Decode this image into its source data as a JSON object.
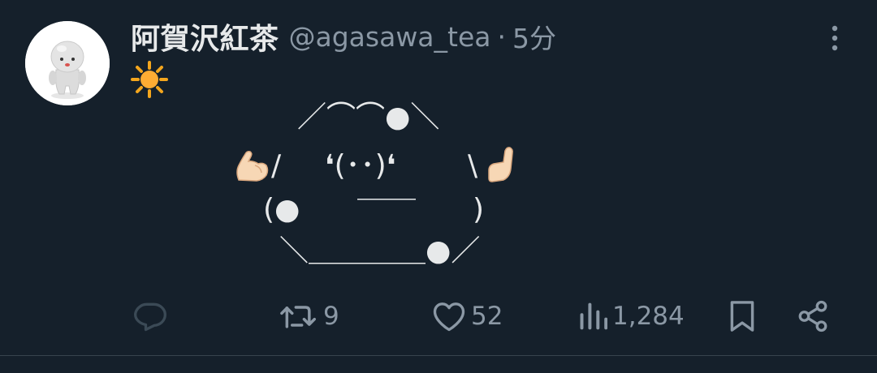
{
  "tweet": {
    "author": {
      "display_name": "阿賀沢紅茶",
      "handle": "@agasawa_tea",
      "separator": "·",
      "time": "5分"
    },
    "body": {
      "emoji_icon": "sun-icon",
      "ascii_art": {
        "line1": "／⌒⌒●＼",
        "line2_left": "/",
        "line2_face": "❛(･･)❛",
        "line2_right": "\\",
        "line3_mouth": "＿＿",
        "line4_left": "(●",
        "line4_right": ")",
        "line5": "＼＿＿＿＿●／",
        "left_icon": "flexed-biceps-icon",
        "right_icon": "raised-hand-icon"
      }
    },
    "actions": {
      "reply": {
        "icon": "reply-icon",
        "count": ""
      },
      "retweet": {
        "icon": "retweet-icon",
        "count": "9"
      },
      "like": {
        "icon": "heart-icon",
        "count": "52"
      },
      "views": {
        "icon": "views-icon",
        "count": "1,284"
      },
      "bookmark": {
        "icon": "bookmark-icon"
      },
      "share": {
        "icon": "share-icon"
      }
    }
  },
  "colors": {
    "background": "#15202b",
    "text_primary": "#e7e9ea",
    "text_secondary": "#8b98a5",
    "divider": "#38444d"
  }
}
